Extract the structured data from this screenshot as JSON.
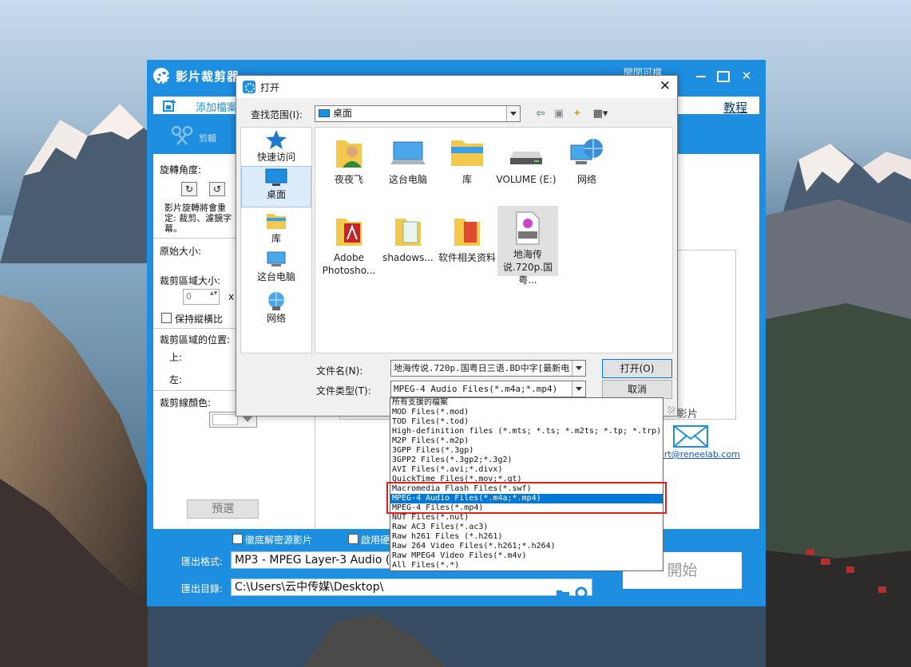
{
  "app": {
    "title": "影片裁剪器",
    "title_hidden": "開閉可檔",
    "toolbar": {
      "add_file": "添加檔案",
      "tutorial": "教程"
    },
    "tabs": [
      {
        "label": "剪輯"
      }
    ],
    "left_panel": {
      "rotation_label": "旋轉角度:",
      "rotation_note": "影片旋轉將會重定: 裁剪、濾鏡字幕。",
      "original_size_label": "原始大小:",
      "crop_size_label": "裁剪區域大小:",
      "crop_width_value": "0",
      "crop_x_sep": "x",
      "keep_ratio_label": "保持縱橫比",
      "crop_position_label": "裁剪區域的位置:",
      "top_label": "上:",
      "left_label": "左:",
      "line_color_label": "裁剪線顏色:",
      "preview_button": "預選"
    },
    "right_panel": {
      "drop_text": "影片",
      "support_link": "ort@reneelab.com"
    },
    "bottom": {
      "decrypt_checkbox": "徹底解密源影片",
      "hw_checkbox": "啟用硬",
      "output_format_label": "匯出格式:",
      "output_format_value": "MP3 - MPEG Layer-3 Audio (*.m",
      "output_dir_label": "匯出目錄:",
      "output_dir_value": "C:\\Users\\云中传媒\\Desktop\\",
      "start_button": "開始"
    }
  },
  "dialog": {
    "title": "打开",
    "look_in_label": "查找范围(I):",
    "look_in_value": "桌面",
    "places": [
      {
        "label": "快速访问"
      },
      {
        "label": "桌面"
      },
      {
        "label": "库"
      },
      {
        "label": "这台电脑"
      },
      {
        "label": "网络"
      }
    ],
    "files": [
      {
        "name": "夜夜飞"
      },
      {
        "name": "这台电脑"
      },
      {
        "name": "库"
      },
      {
        "name": "VOLUME (E:)"
      },
      {
        "name": "网络"
      },
      {
        "name": "Adobe Photosho..."
      },
      {
        "name": "shadows..."
      },
      {
        "name": "软件相关资料"
      },
      {
        "name": "地海传说.720p.国粤..."
      }
    ],
    "filename_label": "文件名(N):",
    "filename_value": "地海传说.720p.国粤日三语.BD中字[最新电",
    "filetype_label": "文件类型(T):",
    "filetype_value": "MPEG-4 Audio Files(*.m4a;*.mp4)",
    "open_button": "打开(O)",
    "cancel_button": "取消"
  },
  "filetype_list": {
    "selected_index": 11,
    "items": [
      "所有支援的檔案",
      "MOD Files(*.mod)",
      "TOD Files(*.tod)",
      "High-definition files (*.mts; *.ts; *.m2ts; *.tp; *.trp)",
      "M2P Files(*.m2p)",
      "3GPP Files(*.3gp)",
      "3GPP2 Files(*.3gp2;*.3g2)",
      "AVI Files(*.avi;*.divx)",
      "QuickTime Files(*.mov;*.qt)",
      "Macromedia Flash Files(*.swf)",
      "MPEG-4 Audio Files(*.m4a;*.mp4)",
      "MPEG-4 Files(*.mp4)",
      "NUT Files(*.nut)",
      "Raw AC3 Files(*.ac3)",
      "Raw h261 Files (*.h261)",
      "Raw 264 Video Files(*.h261;*.h264)",
      "Raw MPEG4 Video Files(*.m4v)",
      "All Files(*.*)"
    ]
  },
  "colors": {
    "app_blue": "#1e8ee0",
    "selection_blue": "#0078d7",
    "highlight_red": "#e0201b"
  }
}
